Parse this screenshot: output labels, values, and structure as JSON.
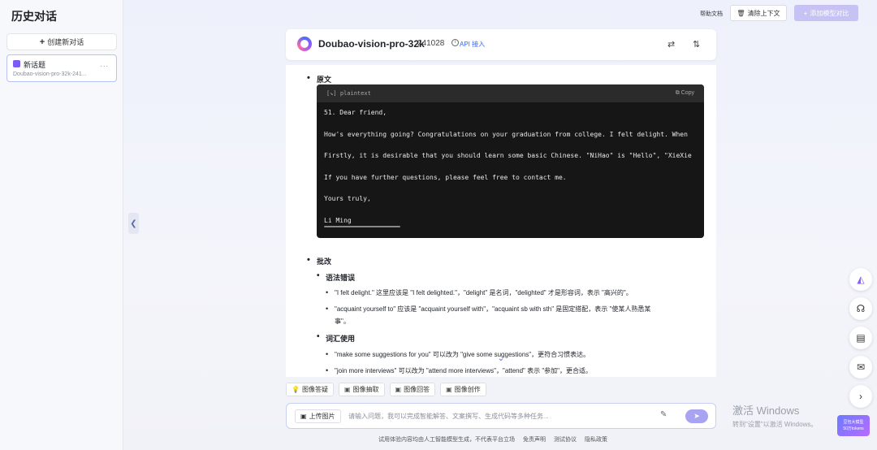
{
  "sidebar": {
    "title": "历史对话",
    "new_chat_label": "创建新对话",
    "history": [
      {
        "title": "新话题",
        "subtitle": "Doubao-vision-pro-32k-241...",
        "more": "..."
      }
    ]
  },
  "topbar": {
    "help_label": "帮助文档",
    "clear_label": "清除上下文",
    "add_model_label": "添加模型对比"
  },
  "model": {
    "name": "Doubao-vision-pro-32k",
    "version": "241028",
    "api_label": "API 接入"
  },
  "message": {
    "section1_title": "原文",
    "code": {
      "lang": "plaintext",
      "copy_label": "Copy",
      "lines": [
        "51. Dear friend,",
        "How's everything going? Congratulations on your graduation from college. I felt delight. When",
        "Firstly, it is desirable that you should learn some basic Chinese. \"NiHao\" is \"Hello\", \"XieXie",
        "If you have further questions, please feel free to contact me.",
        "Yours truly,",
        "Li Ming"
      ]
    },
    "section2_title": "批改",
    "grammar_title": "语法错误",
    "grammar_items": [
      "\"I felt delight.\" 这里应该是 \"I felt delighted.\"，\"delight\" 是名词，\"delighted\" 才是形容词，表示 \"高兴的\"。",
      "\"acquaint yourself to\" 应该是 \"acquaint yourself with\"，\"acquaint sb with sth\" 是固定搭配，表示 \"使某人熟悉某",
      "事\"。"
    ],
    "vocab_title": "词汇使用",
    "vocab_items": [
      "\"make some suggestions for you\" 可以改为 \"give some suggestions\"，更符合习惯表达。",
      "\"join more interviews\" 可以改为 \"attend more interviews\"，\"attend\" 表示 \"参加\"，更合适。"
    ]
  },
  "quick_actions": [
    "图像答疑",
    "图像抽取",
    "图像回答",
    "图像创作"
  ],
  "input": {
    "upload_label": "上传图片",
    "placeholder": "请输入问题，我可以完成智能解答、文案撰写、生成代码等多种任务..."
  },
  "footer": {
    "disclaimer": "试用体验内容均由人工智能模型生成，不代表平台立场",
    "links": [
      "免责声明",
      "测试协议",
      "隐私政策"
    ]
  },
  "windows": {
    "title": "激活 Windows",
    "subtitle": "转到\"设置\"以激活 Windows。"
  },
  "promo": {
    "line1": "豆包大模型",
    "line2": "50万tokens"
  }
}
